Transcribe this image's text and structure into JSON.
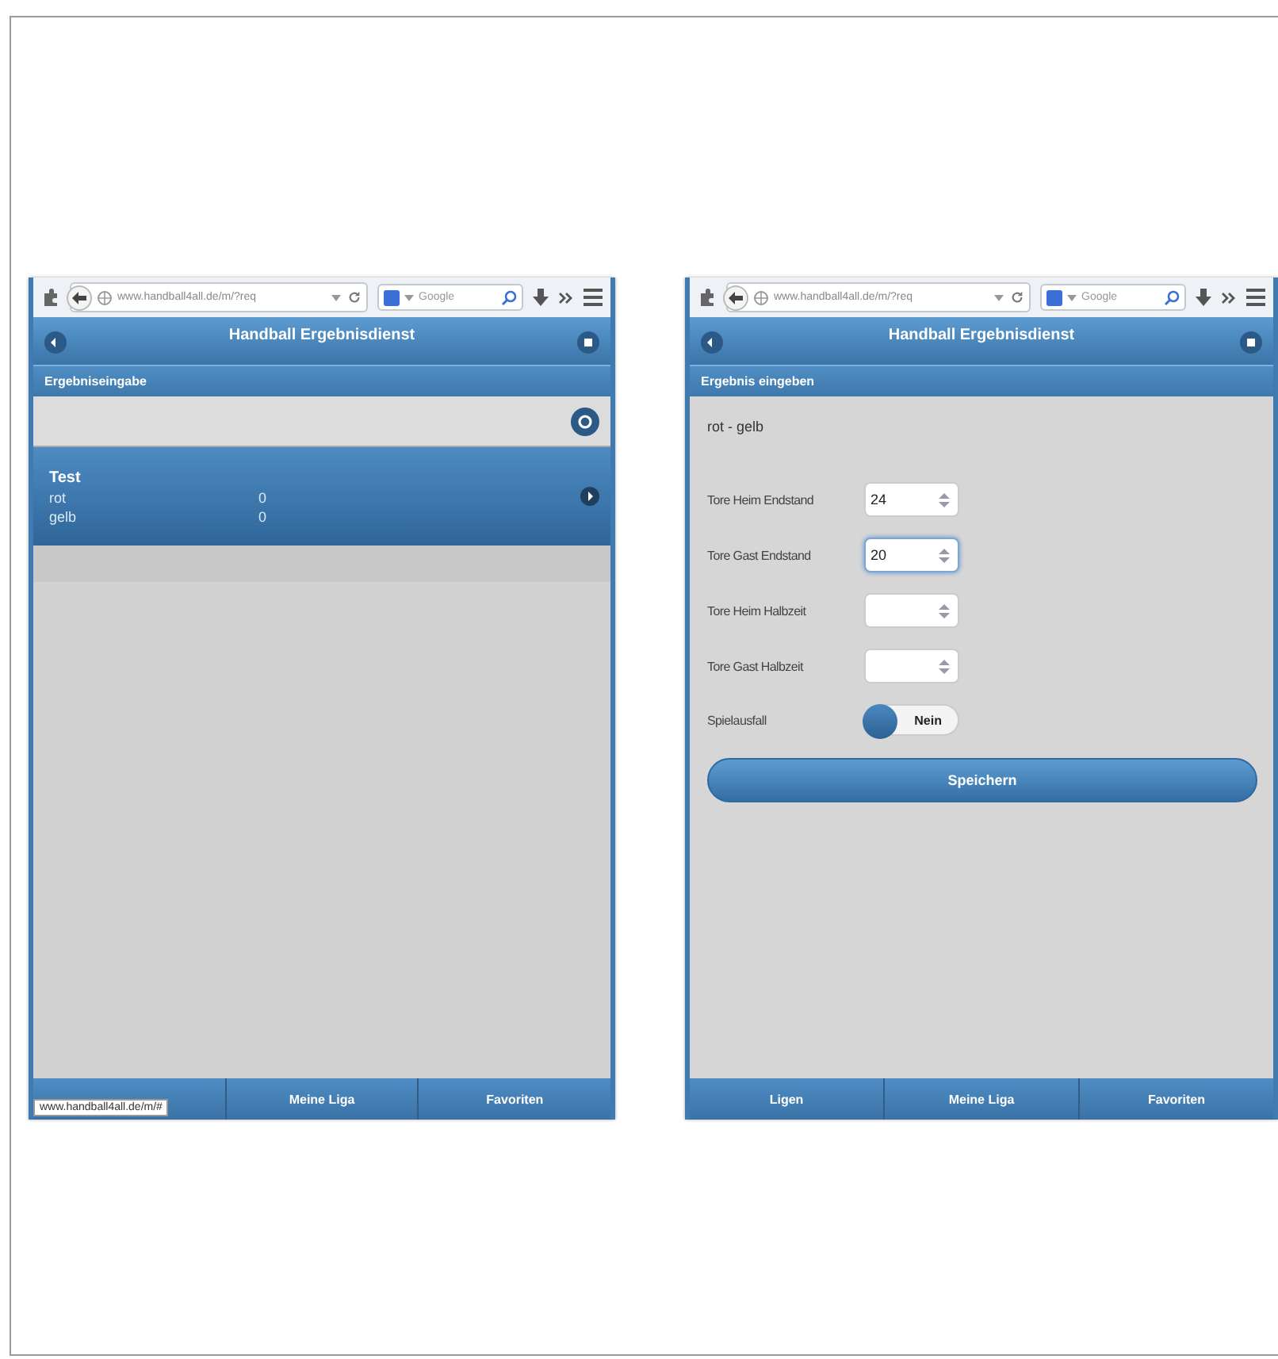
{
  "phones": [
    {
      "kind": "list",
      "browser": {
        "url": "www.handball4all.de/m/?req",
        "search_placeholder": "Google"
      },
      "title": "Handball Ergebnisdienst",
      "subheader": "Ergebniseingabe",
      "games": [
        {
          "title": "Test",
          "teams": [
            {
              "name": "rot",
              "score": "0"
            },
            {
              "name": "gelb",
              "score": "0"
            }
          ]
        }
      ],
      "nav": [
        {
          "kind": "covered"
        },
        {
          "kind": "tab",
          "label": "Meine Liga"
        },
        {
          "kind": "tab",
          "label": "Favoriten"
        }
      ],
      "status_tooltip": "www.handball4all.de/m/#"
    },
    {
      "kind": "form",
      "browser": {
        "url": "www.handball4all.de/m/?req",
        "search_placeholder": "Google"
      },
      "title": "Handball Ergebnisdienst",
      "subheader": "Ergebnis eingeben",
      "match": "rot - gelb",
      "fields": [
        {
          "label": "Tore Heim Endstand",
          "value": "24",
          "focused": false
        },
        {
          "label": "Tore Gast Endstand",
          "value": "20",
          "focused": true
        },
        {
          "label": "Tore Heim Halbzeit",
          "focused": false
        },
        {
          "label": "Tore Gast Halbzeit",
          "focused": false
        }
      ],
      "toggle": {
        "label": "Spielausfall",
        "text": "Nein",
        "on": false
      },
      "submit": "Speichern",
      "nav": [
        {
          "kind": "tab",
          "label": "Ligen"
        },
        {
          "kind": "tab",
          "label": "Meine Liga"
        },
        {
          "kind": "tab",
          "label": "Favoriten"
        }
      ]
    }
  ]
}
